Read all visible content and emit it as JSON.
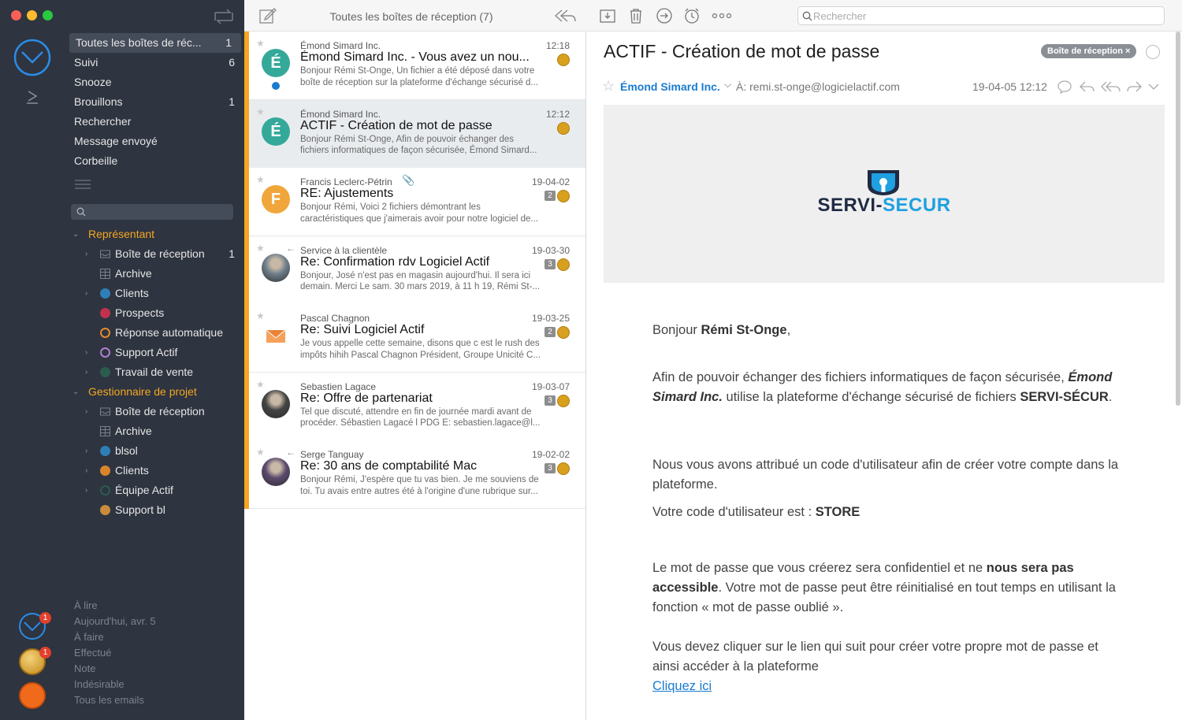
{
  "colors": {
    "accent": "#f5a623",
    "sidebar_bg": "#2e3440",
    "link": "#1a7bd0",
    "unread_dot": "#1a7bd0"
  },
  "sidebar": {
    "nav": [
      {
        "label": "Toutes les boîtes de réc...",
        "count": "1"
      },
      {
        "label": "Suivi",
        "count": "6"
      },
      {
        "label": "Snooze",
        "count": ""
      },
      {
        "label": "Brouillons",
        "count": "1"
      },
      {
        "label": "Rechercher",
        "count": ""
      },
      {
        "label": "Message envoyé",
        "count": ""
      },
      {
        "label": "Corbeille",
        "count": ""
      }
    ],
    "groups": [
      {
        "label": "Représentant",
        "folders": [
          {
            "label": "Boîte de réception",
            "count": "1",
            "icon": "inbox-icon",
            "color": ""
          },
          {
            "label": "Archive",
            "count": "",
            "icon": "archive-icon",
            "color": ""
          },
          {
            "label": "Clients",
            "count": "",
            "icon": "folder-dot-icon",
            "color": "#2e7fb8"
          },
          {
            "label": "Prospects",
            "count": "",
            "icon": "folder-dot-icon",
            "color": "#c0324c"
          },
          {
            "label": "Réponse automatique",
            "count": "",
            "icon": "folder-ring-icon",
            "color": "#e48a2a"
          },
          {
            "label": "Support Actif",
            "count": "",
            "icon": "folder-ring-icon",
            "color": "#b07fcf"
          },
          {
            "label": "Travail de vente",
            "count": "",
            "icon": "folder-dot-icon",
            "color": "#2b5d4f"
          }
        ]
      },
      {
        "label": "Gestionnaire de projet",
        "folders": [
          {
            "label": "Boîte de réception",
            "count": "",
            "icon": "inbox-icon",
            "color": ""
          },
          {
            "label": "Archive",
            "count": "",
            "icon": "archive-icon",
            "color": ""
          },
          {
            "label": "blsol",
            "count": "",
            "icon": "folder-dot-icon",
            "color": "#2e7fb8"
          },
          {
            "label": "Clients",
            "count": "",
            "icon": "folder-dot-icon",
            "color": "#d9862a"
          },
          {
            "label": "Équipe Actif",
            "count": "",
            "icon": "folder-ring-icon",
            "color": "#2b5d4f"
          },
          {
            "label": "Support bl",
            "count": "",
            "icon": "folder-dot-icon",
            "color": "#c98b3c"
          }
        ]
      }
    ],
    "smart": [
      "À lire",
      "Aujourd'hui, avr. 5",
      "À faire",
      "Effectué",
      "Note",
      "Indésirable",
      "Tous les emails"
    ],
    "badges": [
      "1",
      "1"
    ]
  },
  "list": {
    "title": "Toutes les boîtes de réception (7)",
    "messages": [
      {
        "sender": "Émond Simard Inc.",
        "date": "12:18",
        "subject": "Émond Simard Inc. - Vous avez un nou...",
        "preview": "Bonjour Rémi St-Onge, Un fichier a été déposé dans votre boîte de réception sur la plateforme d'échange sécurisé d...",
        "avatar": "É",
        "avatar_color": "#34a99a",
        "badge": "",
        "unread": true
      },
      {
        "sender": "Émond Simard Inc.",
        "date": "12:12",
        "subject": "ACTIF - Création de mot de passe",
        "preview": "Bonjour Rémi St-Onge, Afin de pouvoir échanger des fichiers informatiques de façon sécurisée, Émond Simard...",
        "avatar": "É",
        "avatar_color": "#34a99a",
        "badge": "",
        "unread": false
      },
      {
        "sender": "Francis Leclerc-Pétrin",
        "date": "19-04-02",
        "subject": "RE: Ajustements",
        "preview": "Bonjour Rémi, Voici 2 fichiers démontrant les caractéristiques que j'aimerais avoir pour notre logiciel de...",
        "avatar": "F",
        "avatar_color": "#f0a63a",
        "badge": "2",
        "unread": false
      },
      {
        "sender": "Service à la clientèle",
        "date": "19-03-30",
        "subject": "Re: Confirmation rdv Logiciel Actif",
        "preview": "Bonjour, José n'est pas en magasin aujourd'hui. Il sera ici demain. Merci Le sam. 30 mars 2019, à 11 h 19, Rémi St-...",
        "avatar": "",
        "avatar_color": "#6f7f8c",
        "badge": "3",
        "unread": false
      },
      {
        "sender": "Pascal Chagnon",
        "date": "19-03-25",
        "subject": "Re: Suivi Logiciel Actif",
        "preview": "Je vous appelle cette semaine, disons que c est le rush des impôts hihih Pascal Chagnon Président, Groupe Unicité C...",
        "avatar": "",
        "avatar_color": "#ffffff",
        "badge": "2",
        "unread": false
      },
      {
        "sender": "Sebastien Lagace",
        "date": "19-03-07",
        "subject": "Re: Offre de partenariat",
        "preview": "Tel que discuté, attendre en fin de journée mardi avant de procéder. Sébastien Lagacé l PDG E: sebastien.lagace@l...",
        "avatar": "",
        "avatar_color": "#444444",
        "badge": "3",
        "unread": false
      },
      {
        "sender": "Serge Tanguay",
        "date": "19-02-02",
        "subject": "Re: 30 ans de comptabilité Mac",
        "preview": "Bonjour Rémi, J'espère que tu vas bien. Je me souviens de toi. Tu avais entre autres été à l'origine d'une rubrique sur...",
        "avatar": "",
        "avatar_color": "#5b4a6e",
        "badge": "3",
        "unread": false
      }
    ]
  },
  "reader": {
    "search_placeholder": "Rechercher",
    "subject": "ACTIF - Création de mot de passe",
    "tag": "Boîte de réception ×",
    "from": "Émond Simard Inc.",
    "to": "À: remi.st-onge@logicielactif.com",
    "datetime": "19-04-05 12:12",
    "logo_text_a": "SERVI-",
    "logo_text_b": "SECUR",
    "greeting_a": "Bonjour ",
    "greeting_name": "Rémi St-Onge",
    "greeting_b": ",",
    "p1_a": "Afin de pouvoir échanger des fichiers informatiques de façon sécurisée, ",
    "p1_company": "Émond Simard Inc.",
    "p1_b": " utilise la plateforme d'échange sécurisé de fichiers ",
    "p1_brand": "SERVI-SÉCUR",
    "p1_c": ".",
    "p2": "Nous vous avons attribué un code d'utilisateur afin de créer votre compte dans la plateforme.",
    "p3_a": "Votre code d'utilisateur est : ",
    "p3_code": "STORE",
    "p4_a": "Le mot de passe que vous créerez sera confidentiel et ne ",
    "p4_bold": "nous sera pas accessible",
    "p4_b": ". Votre mot de passe peut être réinitialisé en tout temps en utilisant la fonction « mot de passe oublié ».",
    "p5": "Vous devez cliquer sur le lien qui suit pour créer votre propre mot de passe et ainsi accéder à la plateforme",
    "link": "Cliquez ici"
  }
}
